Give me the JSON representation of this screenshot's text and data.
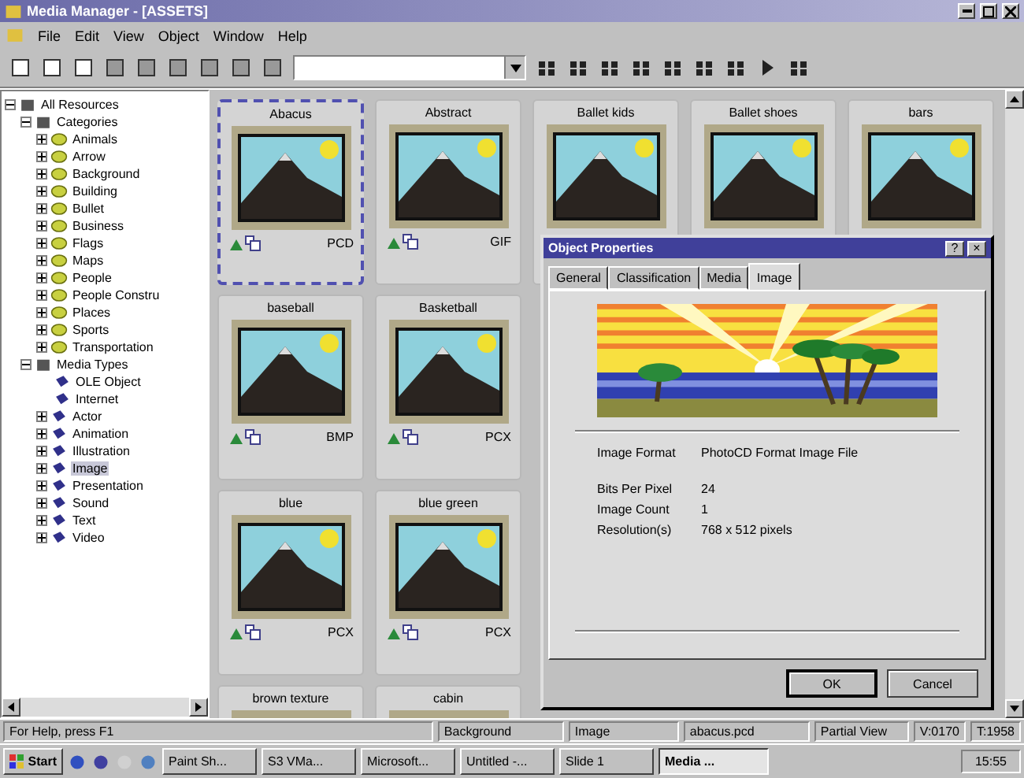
{
  "window": {
    "title": "Media Manager - [ASSETS]"
  },
  "menu": [
    "File",
    "Edit",
    "View",
    "Object",
    "Window",
    "Help"
  ],
  "tree": [
    {
      "label": "All Resources",
      "kind": "root",
      "expanded": true,
      "selected": false,
      "children": [
        {
          "label": "Categories",
          "kind": "root",
          "expanded": true,
          "selected": false,
          "children": [
            {
              "label": "Animals",
              "kind": "category",
              "expanded": false,
              "selected": false
            },
            {
              "label": "Arrow",
              "kind": "category",
              "expanded": false,
              "selected": false
            },
            {
              "label": "Background",
              "kind": "category",
              "expanded": false,
              "selected": false
            },
            {
              "label": "Building",
              "kind": "category",
              "expanded": false,
              "selected": false
            },
            {
              "label": "Bullet",
              "kind": "category",
              "expanded": false,
              "selected": false
            },
            {
              "label": "Business",
              "kind": "category",
              "expanded": false,
              "selected": false
            },
            {
              "label": "Flags",
              "kind": "category",
              "expanded": false,
              "selected": false
            },
            {
              "label": "Maps",
              "kind": "category",
              "expanded": false,
              "selected": false
            },
            {
              "label": "People",
              "kind": "category",
              "expanded": false,
              "selected": false
            },
            {
              "label": "People Constru",
              "kind": "category",
              "expanded": false,
              "selected": false
            },
            {
              "label": "Places",
              "kind": "category",
              "expanded": false,
              "selected": false
            },
            {
              "label": "Sports",
              "kind": "category",
              "expanded": false,
              "selected": false
            },
            {
              "label": "Transportation",
              "kind": "category",
              "expanded": false,
              "selected": false
            }
          ]
        },
        {
          "label": "Media Types",
          "kind": "root",
          "expanded": true,
          "selected": false,
          "children": [
            {
              "label": "OLE Object",
              "kind": "media",
              "selected": false
            },
            {
              "label": "Internet",
              "kind": "media",
              "selected": false
            },
            {
              "label": "Actor",
              "kind": "media",
              "expanded": false,
              "selected": false
            },
            {
              "label": "Animation",
              "kind": "media",
              "expanded": false,
              "selected": false
            },
            {
              "label": "Illustration",
              "kind": "media",
              "expanded": false,
              "selected": false
            },
            {
              "label": "Image",
              "kind": "media",
              "expanded": false,
              "selected": true
            },
            {
              "label": "Presentation",
              "kind": "media",
              "expanded": false,
              "selected": false
            },
            {
              "label": "Sound",
              "kind": "media",
              "expanded": false,
              "selected": false
            },
            {
              "label": "Text",
              "kind": "media",
              "expanded": false,
              "selected": false
            },
            {
              "label": "Video",
              "kind": "media",
              "expanded": false,
              "selected": false
            }
          ]
        }
      ]
    }
  ],
  "card_rows": [
    [
      {
        "name": "Abacus",
        "format": "PCD",
        "selected": true
      },
      {
        "name": "Abstract",
        "format": "GIF",
        "selected": false
      },
      {
        "name": "Ballet kids",
        "selected": false
      },
      {
        "name": "Ballet shoes",
        "selected": false
      },
      {
        "name": "bars",
        "selected": false
      }
    ],
    [
      {
        "name": "baseball",
        "format": "BMP",
        "selected": false
      },
      {
        "name": "Basketball",
        "format": "PCX",
        "selected": false
      }
    ],
    [
      {
        "name": "blue",
        "format": "PCX",
        "selected": false
      },
      {
        "name": "blue green",
        "format": "PCX",
        "selected": false
      }
    ],
    [
      {
        "name": "brown texture",
        "selected": false
      },
      {
        "name": "cabin",
        "selected": false
      }
    ]
  ],
  "dialog": {
    "title": "Object Properties",
    "help": "?",
    "close": "×",
    "tabs": [
      {
        "label": "General",
        "selected": false
      },
      {
        "label": "Classification",
        "selected": false
      },
      {
        "label": "Media",
        "selected": false
      },
      {
        "label": "Image",
        "selected": true
      }
    ],
    "properties": [
      {
        "label": "Image Format",
        "value": "PhotoCD Format Image File"
      },
      {
        "label": "Bits Per Pixel",
        "value": "24"
      },
      {
        "label": "Image Count",
        "value": "1"
      },
      {
        "label": "Resolution(s)",
        "value": "768 x 512 pixels"
      }
    ],
    "buttons": [
      "OK",
      "Cancel"
    ]
  },
  "status_bar": [
    "For Help, press F1",
    "Background",
    "Image",
    "abacus.pcd",
    "Partial View",
    "V:0170",
    "T:1958"
  ],
  "taskbar": {
    "start": "Start",
    "tasks": [
      {
        "label": "Paint Sh...",
        "selected": false
      },
      {
        "label": "S3 VMa...",
        "selected": false
      },
      {
        "label": "Microsoft...",
        "selected": false
      },
      {
        "label": "Untitled -...",
        "selected": false
      },
      {
        "label": "Slide 1",
        "selected": false
      },
      {
        "label": "Media ...",
        "selected": true
      }
    ],
    "clock": "15:55"
  }
}
